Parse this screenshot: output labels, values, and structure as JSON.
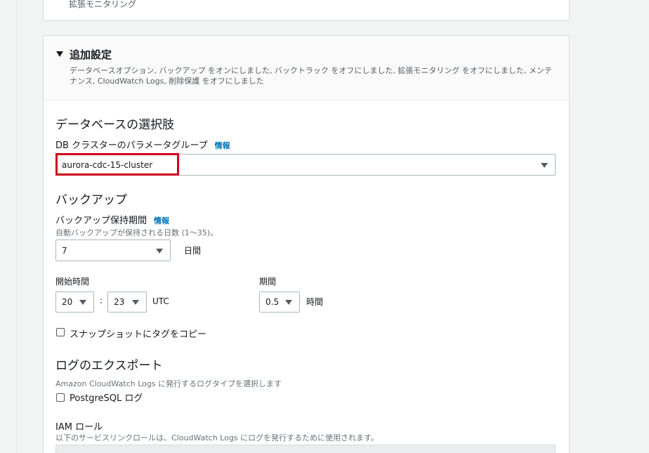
{
  "previous_section": {
    "trailing_text": "拡張モニタリング"
  },
  "additional_config": {
    "title": "追加設定",
    "description": "データベースオプション, バックアップ をオンにしました, バックトラック をオフにしました, 拡張モニタリング をオフにしました, メンテナンス, CloudWatch Logs, 削除保護 をオフにしました"
  },
  "db_options": {
    "title": "データベースの選択肢",
    "param_group_label": "DB クラスターのパラメータグループ",
    "info": "情報",
    "param_group_value": "aurora-cdc-15-cluster"
  },
  "backup": {
    "title": "バックアップ",
    "retention_label": "バックアップ保持期間",
    "info": "情報",
    "retention_hint": "自動バックアップが保持される日数 (1〜35)。",
    "retention_value": "7",
    "retention_unit": "日間",
    "start_time_label": "開始時間",
    "hour_value": "20",
    "colon": ":",
    "minute_value": "23",
    "tz": "UTC",
    "duration_label": "期間",
    "duration_value": "0.5",
    "duration_unit": "時間",
    "copy_tags_label": "スナップショットにタグをコピー"
  },
  "log_export": {
    "title": "ログのエクスポート",
    "hint": "Amazon CloudWatch Logs に発行するログタイプを選択します",
    "postgresql_label": "PostgreSQL ログ"
  },
  "iam": {
    "label": "IAM ロール",
    "hint": "以下のサービスリンクロールは、CloudWatch Logs にログを発行するために使用されます。"
  },
  "colors": {
    "highlight": "#d0021b",
    "link": "#0073bb"
  }
}
